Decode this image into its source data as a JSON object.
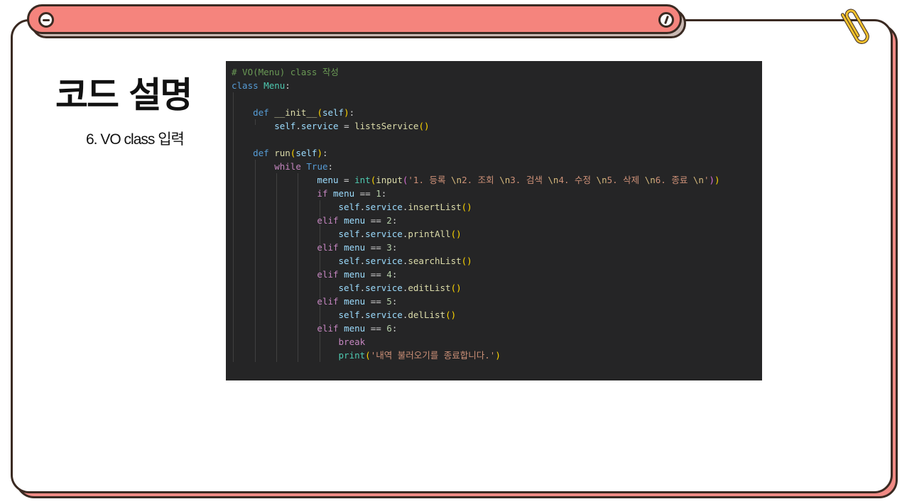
{
  "slide": {
    "title": "코드 설명",
    "subtitle": "6. VO class 입력"
  },
  "colors": {
    "tab_fill": "#f5847d",
    "card_shadow": "#f08a84",
    "outline": "#3a2a22",
    "code_bg": "#252526",
    "clip": "#f2c12e"
  },
  "icons": {
    "tab_left": "minus-circle-icon",
    "tab_right": "slash-circle-icon",
    "clip": "paperclip-icon"
  },
  "code": {
    "language": "python",
    "lines": [
      "# VO(Menu) class 작성",
      "class Menu:",
      "",
      "    def __init__(self):",
      "        self.service = listsService()",
      "",
      "    def run(self):",
      "        while True:",
      "                menu = int(input('1. 등록 \\n2. 조회 \\n3. 검색 \\n4. 수정 \\n5. 삭제 \\n6. 종료 \\n'))",
      "                if menu == 1:",
      "                    self.service.insertList()",
      "                elif menu == 2:",
      "                    self.service.printAll()",
      "                elif menu == 3:",
      "                    self.service.searchList()",
      "                elif menu == 4:",
      "                    self.service.editList()",
      "                elif menu == 5:",
      "                    self.service.delList()",
      "                elif menu == 6:",
      "                    break",
      "                    print('내역 불러오기를 종료합니다.')"
    ]
  }
}
